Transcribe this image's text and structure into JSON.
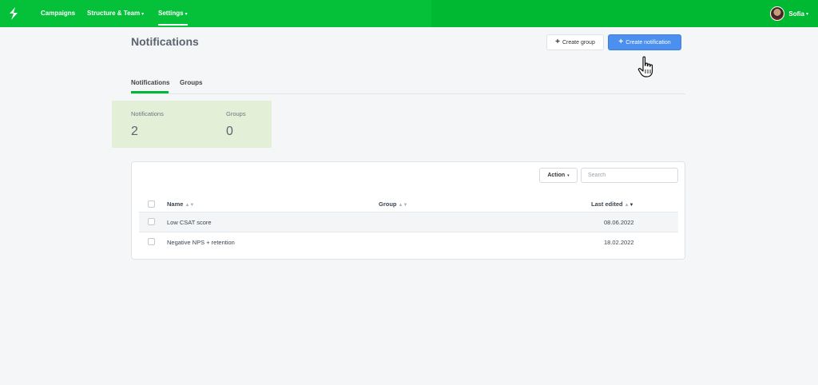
{
  "nav": {
    "items": [
      {
        "label": "Campaigns",
        "has_caret": false
      },
      {
        "label": "Structure & Team",
        "has_caret": true
      },
      {
        "label": "Settings",
        "has_caret": true,
        "active": true
      }
    ],
    "user": {
      "name": "Sofia"
    },
    "caret_glyph": "▾"
  },
  "header": {
    "title": "Notifications",
    "create_group_label": "Create group",
    "create_notification_label": "Create notification",
    "plus_glyph": "+"
  },
  "tabs": [
    {
      "label": "Notifications",
      "active": true
    },
    {
      "label": "Groups",
      "active": false
    }
  ],
  "stats": [
    {
      "label": "Notifications",
      "value": "2"
    },
    {
      "label": "Groups",
      "value": "0"
    }
  ],
  "table": {
    "action_label": "Action",
    "search_placeholder": "Search",
    "columns": [
      {
        "label": "Name",
        "sort": "▲▼"
      },
      {
        "label": "Group",
        "sort": "▲▼"
      },
      {
        "label": "Last edited",
        "sort_up": "▲",
        "sort_down": "▼"
      }
    ],
    "rows": [
      {
        "name": "Low CSAT score",
        "group": "",
        "last_edited": "08.06.2022"
      },
      {
        "name": "Negative NPS + retention",
        "group": "",
        "last_edited": "18.02.2022"
      }
    ]
  },
  "colors": {
    "brand_green": "#00b932",
    "primary_blue": "#4b8ff0",
    "stats_bg": "#e4efd8"
  }
}
